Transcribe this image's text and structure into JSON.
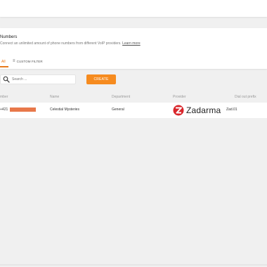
{
  "header": {
    "title": "Numbers",
    "description": "Connect an unlimited amount of phone numbers from different VoIP providers.",
    "learn_more": "Learn more",
    "tabs": {
      "all": "All",
      "custom_filter": "CUSTOM FILTER"
    }
  },
  "toolbar": {
    "search_placeholder": "Search ...",
    "create_label": "CREATE"
  },
  "table": {
    "columns": [
      "mber",
      "Name",
      "Department",
      "Provider",
      "Dial out prefix"
    ],
    "rows": [
      {
        "number_partial": "+421",
        "name": "Celestial Mysteries",
        "department": "General",
        "provider": "Zadarma",
        "dial_out_prefix": "Zad.01"
      }
    ]
  },
  "colors": {
    "accent": "#f68b1f",
    "tab_active": "#e87a1d",
    "zadarma_red": "#d9262b"
  },
  "icons": {
    "search": "search-icon",
    "filter": "filter-icon",
    "provider_logo": "zadarma-logo-icon"
  }
}
